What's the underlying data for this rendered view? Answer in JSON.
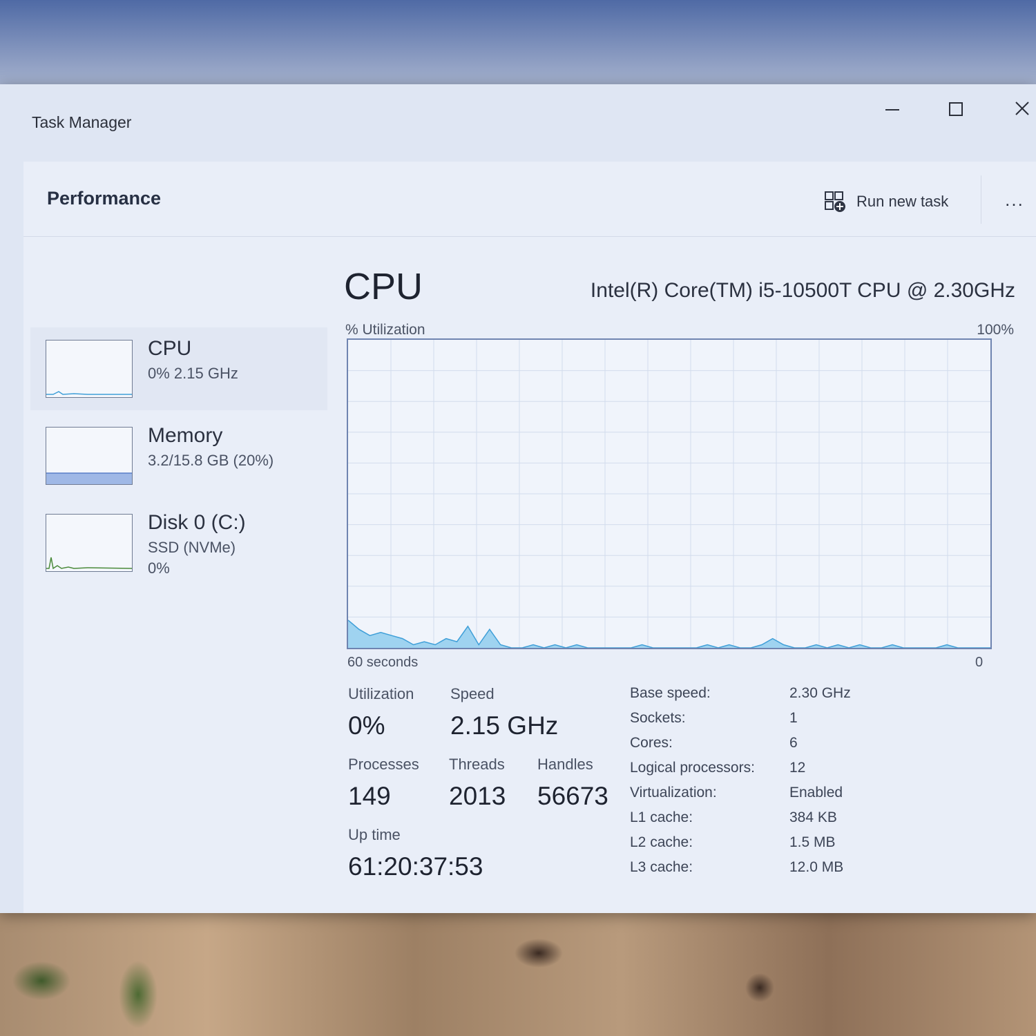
{
  "window": {
    "title": "Task Manager"
  },
  "header": {
    "page_title": "Performance",
    "run_new_task": "Run new task",
    "more": "..."
  },
  "sidebar": {
    "items": [
      {
        "name": "CPU",
        "line1": "0%  2.15 GHz",
        "selected": true
      },
      {
        "name": "Memory",
        "line1": "3.2/15.8 GB (20%)"
      },
      {
        "name": "Disk 0 (C:)",
        "line1": "SSD (NVMe)",
        "line2": "0%"
      }
    ]
  },
  "main": {
    "title": "CPU",
    "model": "Intel(R) Core(TM) i5-10500T CPU @ 2.30GHz",
    "graph": {
      "y_label": "% Utilization",
      "y_max_label": "100%",
      "x_left_label": "60 seconds",
      "x_right_label": "0",
      "color": "#3f9fd8",
      "fill": "#9fd3f0",
      "values": [
        9,
        6,
        4,
        5,
        4,
        3,
        1,
        2,
        1,
        3,
        2,
        7,
        1,
        6,
        1,
        0,
        0,
        1,
        0,
        1,
        0,
        1,
        0,
        0,
        0,
        0,
        0,
        1,
        0,
        0,
        0,
        0,
        0,
        1,
        0,
        1,
        0,
        0,
        1,
        3,
        1,
        0,
        0,
        1,
        0,
        1,
        0,
        1,
        0,
        0,
        1,
        0,
        0,
        0,
        0,
        1,
        0,
        0,
        0,
        0
      ]
    },
    "stats": {
      "utilization_label": "Utilization",
      "utilization_value": "0%",
      "speed_label": "Speed",
      "speed_value": "2.15 GHz",
      "processes_label": "Processes",
      "processes_value": "149",
      "threads_label": "Threads",
      "threads_value": "2013",
      "handles_label": "Handles",
      "handles_value": "56673",
      "uptime_label": "Up time",
      "uptime_value": "61:20:37:53"
    },
    "specs": [
      {
        "label": "Base speed:",
        "value": "2.30 GHz"
      },
      {
        "label": "Sockets:",
        "value": "1"
      },
      {
        "label": "Cores:",
        "value": "6"
      },
      {
        "label": "Logical processors:",
        "value": "12"
      },
      {
        "label": "Virtualization:",
        "value": "Enabled"
      },
      {
        "label": "L1 cache:",
        "value": "384 KB"
      },
      {
        "label": "L2 cache:",
        "value": "1.5 MB"
      },
      {
        "label": "L3 cache:",
        "value": "12.0 MB"
      }
    ]
  }
}
